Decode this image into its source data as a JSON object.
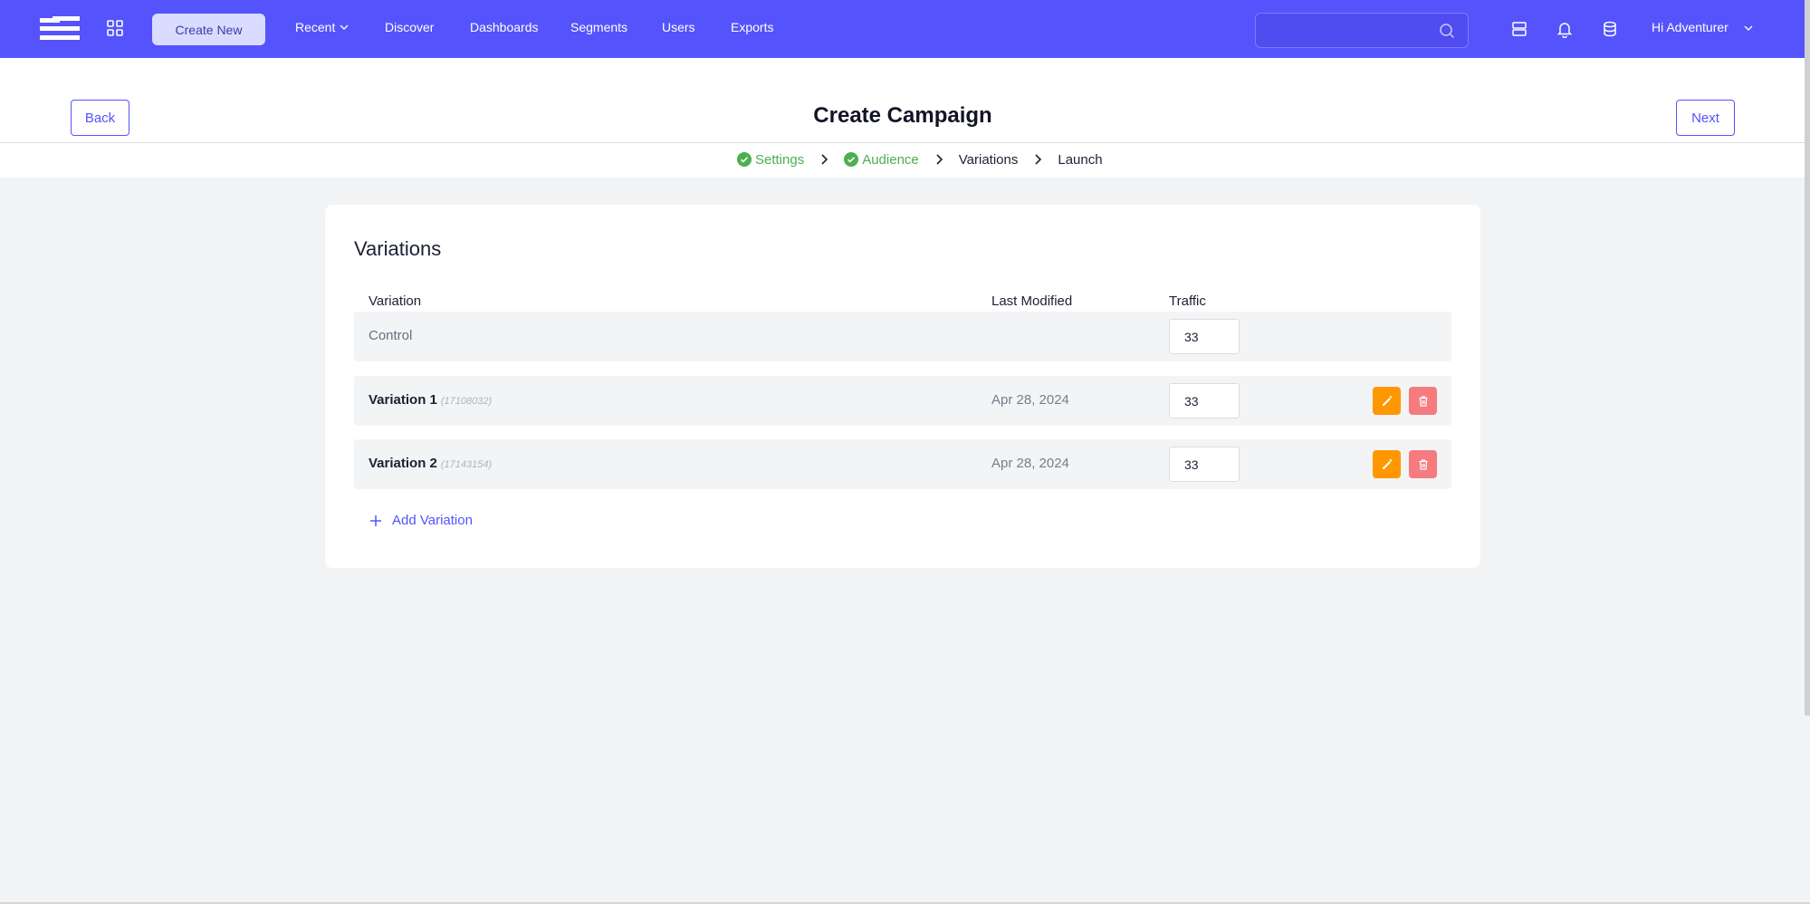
{
  "topbar": {
    "create_new_label": "Create New",
    "nav": [
      {
        "label": "Recent"
      },
      {
        "label": "Discover"
      },
      {
        "label": "Dashboards"
      },
      {
        "label": "Segments"
      },
      {
        "label": "Users"
      },
      {
        "label": "Exports"
      }
    ],
    "search_value": "",
    "greeting": "Hi Adventurer"
  },
  "header": {
    "title": "Create Campaign",
    "back_label": "Back",
    "next_label": "Next",
    "steps": [
      {
        "label": "Settings",
        "status": "done"
      },
      {
        "label": "Audience",
        "status": "done"
      },
      {
        "label": "Variations",
        "status": "current"
      },
      {
        "label": "Launch",
        "status": "pending"
      }
    ]
  },
  "variations": {
    "title": "Variations",
    "columns": {
      "variation": "Variation",
      "last_modified": "Last Modified",
      "traffic": "Traffic"
    },
    "rows": [
      {
        "name": "Control",
        "id": "",
        "modified": "",
        "traffic": "33"
      },
      {
        "name": "Variation 1",
        "id": "(17108032)",
        "modified": "Apr 28, 2024",
        "traffic": "33"
      },
      {
        "name": "Variation 2",
        "id": "(17143154)",
        "modified": "Apr 28, 2024",
        "traffic": "33"
      }
    ],
    "add_label": "Add Variation"
  },
  "colors": {
    "brand": "#5553fb",
    "success": "#4caf50",
    "edit": "#ff9800",
    "delete": "#f67b7f"
  },
  "icons": [
    "menu-logo-icon",
    "apps-grid-icon",
    "chevron-down-icon",
    "search-icon",
    "stack-icon",
    "bell-icon",
    "database-icon",
    "check-circle-icon",
    "chevron-right-icon",
    "pencil-icon",
    "trash-icon",
    "plus-icon"
  ]
}
